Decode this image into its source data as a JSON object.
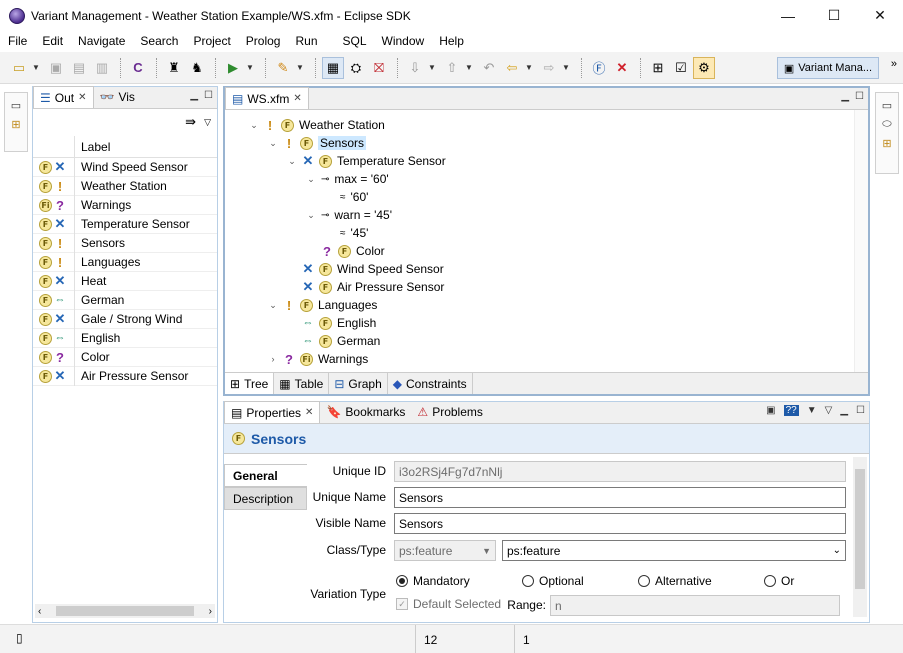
{
  "window": {
    "title": "Variant Management - Weather Station Example/WS.xfm - Eclipse SDK",
    "controls": [
      "—",
      "☐",
      "✕"
    ]
  },
  "menu": [
    "File",
    "Edit",
    "Navigate",
    "Search",
    "Project",
    "Prolog",
    "Run",
    "SQL",
    "Window",
    "Help"
  ],
  "toolbar": {
    "perspective_label": "Variant Mana...",
    "more": "»"
  },
  "outline_panel": {
    "tabs": [
      {
        "label": "Out",
        "icon": "outline-icon"
      },
      {
        "label": "Vis",
        "icon": "glasses-icon"
      }
    ],
    "column_header": "Label",
    "rows": [
      {
        "label": "Wind Speed Sensor",
        "type": "alternative",
        "fi": "F"
      },
      {
        "label": "Weather Station",
        "type": "mandatory",
        "fi": "F"
      },
      {
        "label": "Warnings",
        "type": "optional",
        "fi": "Fi"
      },
      {
        "label": "Temperature Sensor",
        "type": "alternative",
        "fi": "F"
      },
      {
        "label": "Sensors",
        "type": "mandatory",
        "fi": "F"
      },
      {
        "label": "Languages",
        "type": "mandatory",
        "fi": "F"
      },
      {
        "label": "Heat",
        "type": "alternative",
        "fi": "F"
      },
      {
        "label": "German",
        "type": "or",
        "fi": "F"
      },
      {
        "label": "Gale / Strong Wind",
        "type": "alternative",
        "fi": "F"
      },
      {
        "label": "English",
        "type": "or",
        "fi": "F"
      },
      {
        "label": "Color",
        "type": "optional",
        "fi": "F"
      },
      {
        "label": "Air Pressure Sensor",
        "type": "alternative",
        "fi": "F"
      }
    ]
  },
  "editor": {
    "tab": "WS.xfm",
    "tree": [
      {
        "label": "Weather Station",
        "type": "mandatory",
        "fi": "F",
        "twisty": "open",
        "depth": 0
      },
      {
        "label": "Sensors",
        "type": "mandatory",
        "fi": "F",
        "twisty": "open",
        "depth": 1,
        "selected": true
      },
      {
        "label": "Temperature Sensor",
        "type": "alternative",
        "fi": "F",
        "twisty": "open",
        "depth": 2
      },
      {
        "label": "max = '60'",
        "type": "attr",
        "twisty": "open",
        "depth": 3
      },
      {
        "label": "'60'",
        "type": "value",
        "twisty": "",
        "depth": 4
      },
      {
        "label": "warn = '45'",
        "type": "attr",
        "twisty": "open",
        "depth": 3
      },
      {
        "label": "'45'",
        "type": "value",
        "twisty": "",
        "depth": 4
      },
      {
        "label": "Color",
        "type": "optional",
        "fi": "F",
        "twisty": "",
        "depth": 3
      },
      {
        "label": "Wind Speed Sensor",
        "type": "alternative",
        "fi": "F",
        "twisty": "",
        "depth": 2
      },
      {
        "label": "Air Pressure Sensor",
        "type": "alternative",
        "fi": "F",
        "twisty": "",
        "depth": 2
      },
      {
        "label": "Languages",
        "type": "mandatory",
        "fi": "F",
        "twisty": "open",
        "depth": 1
      },
      {
        "label": "English",
        "type": "or",
        "fi": "F",
        "twisty": "",
        "depth": 2
      },
      {
        "label": "German",
        "type": "or",
        "fi": "F",
        "twisty": "",
        "depth": 2
      },
      {
        "label": "Warnings",
        "type": "optional",
        "fi": "Fi",
        "twisty": "closed",
        "depth": 1
      }
    ],
    "bottom_tabs": [
      "Tree",
      "Table",
      "Graph",
      "Constraints"
    ]
  },
  "properties": {
    "tabs": [
      "Properties",
      "Bookmarks",
      "Problems"
    ],
    "title": "Sensors",
    "vtabs": [
      "General",
      "Description"
    ],
    "fields": {
      "unique_id_label": "Unique ID",
      "unique_id": "i3o2RSj4Fg7d7nNlj",
      "unique_name_label": "Unique Name",
      "unique_name": "Sensors",
      "visible_name_label": "Visible Name",
      "visible_name": "Sensors",
      "class_type_label": "Class/Type",
      "class": "ps:feature",
      "type": "ps:feature",
      "variation_type_label": "Variation Type",
      "variation_options": [
        "Mandatory",
        "Optional",
        "Alternative",
        "Or"
      ],
      "variation_selected": "Mandatory",
      "default_selected_label": "Default Selected",
      "range_label": "Range:",
      "range_value": "n"
    }
  },
  "status": {
    "cell1": "12",
    "cell2": "1"
  }
}
